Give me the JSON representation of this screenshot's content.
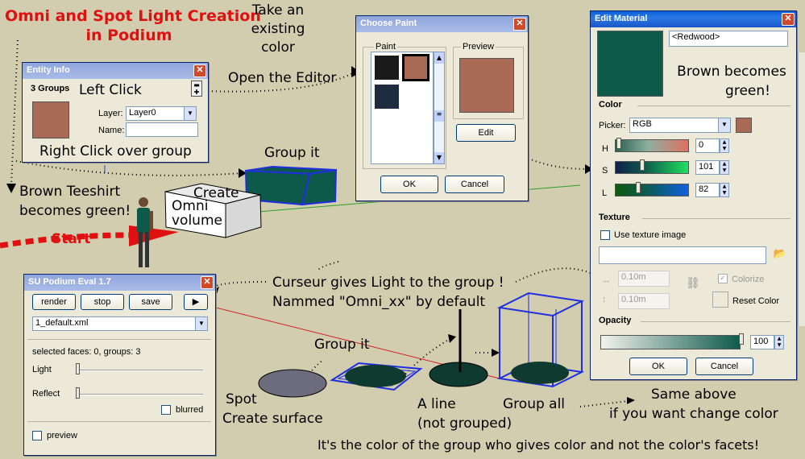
{
  "colors": {
    "background": "#d2cdaf",
    "brown": "#a86a54",
    "green": "#0e5a4a",
    "title_red": "#e01010"
  },
  "annotations": {
    "title_line1": "Omni and Spot Light Creation",
    "title_line2": "in Podium",
    "take_existing": [
      "Take an",
      "existing",
      "color"
    ],
    "open_editor": "Open the Editor",
    "left_click": "Left Click",
    "right_click": "Right Click over group",
    "group_it_top": "Group it",
    "create": "Create",
    "omni_volume": [
      "Omni",
      "volume"
    ],
    "brown_teeshirt": [
      "Brown Teeshirt",
      "becomes green!"
    ],
    "start": "Start",
    "brown_becomes_green": [
      "Brown becomes",
      "green!"
    ],
    "curseur": [
      "Curseur gives Light to the group !",
      "Nammed \"Omni_xx\" by default"
    ],
    "group_it_bottom": "Group it",
    "spot": [
      "Spot",
      "Create surface"
    ],
    "a_line": [
      "A line",
      "(not grouped)"
    ],
    "group_all": "Group all",
    "same_above": [
      "Same above",
      "if you want change color"
    ],
    "footer": "It's the color of the group who gives color and not the color's facets!"
  },
  "entity_info": {
    "title": "Entity Info",
    "count": "3 Groups",
    "layer_label": "Layer:",
    "layer_value": "Layer0",
    "name_label": "Name:",
    "name_value": ""
  },
  "choose_paint": {
    "title": "Choose Paint",
    "paint_label": "Paint",
    "preview_label": "Preview",
    "edit": "Edit",
    "ok": "OK",
    "cancel": "Cancel"
  },
  "edit_material": {
    "title": "Edit Material",
    "name": "<Redwood>",
    "color_header": "Color",
    "picker_label": "Picker:",
    "picker_value": "RGB",
    "h_label": "H",
    "h_value": "0",
    "s_label": "S",
    "s_value": "101",
    "l_label": "L",
    "l_value": "82",
    "texture_header": "Texture",
    "use_texture": "Use texture image",
    "width_value": "0.10m",
    "height_value": "0.10m",
    "colorize": "Colorize",
    "reset_color": "Reset Color",
    "opacity_header": "Opacity",
    "opacity_value": "100",
    "ok": "OK",
    "cancel": "Cancel"
  },
  "podium": {
    "title": "SU Podium Eval 1.7",
    "render": "render",
    "stop": "stop",
    "save": "save",
    "play": "▶",
    "file": "1_default.xml",
    "selected": "selected faces: 0, groups: 3",
    "light": "Light",
    "reflect": "Reflect",
    "blurred": "blurred",
    "preview": "preview"
  }
}
